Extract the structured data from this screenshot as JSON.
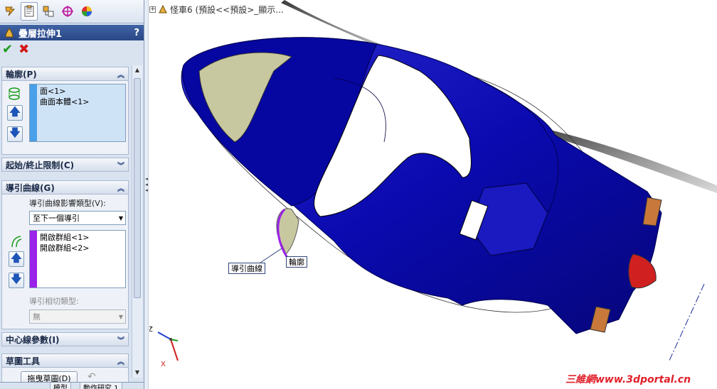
{
  "tabs": [
    {
      "icon": "feature-manager-icon",
      "active": false
    },
    {
      "icon": "property-manager-icon",
      "active": true
    },
    {
      "icon": "configuration-manager-icon",
      "active": false
    },
    {
      "icon": "dimxpert-icon",
      "active": false
    },
    {
      "icon": "display-manager-icon",
      "active": false
    }
  ],
  "property_manager": {
    "title": "疊層拉伸1",
    "help": "?"
  },
  "groups": {
    "profile": {
      "title": "輪廓(P)",
      "items": [
        "面<1>",
        "曲面本體<1>"
      ],
      "list_color": "#4aa0e8"
    },
    "start_end": {
      "title": "起始/終止限制(C)"
    },
    "guides": {
      "title": "導引曲線(G)",
      "influence_label": "導引曲線影響類型(V):",
      "influence_value": "至下一個導引",
      "items": [
        "開啟群組<1>",
        "開啟群組<2>"
      ],
      "list_color": "#9b22e8",
      "tangency_label": "導引相切類型:",
      "tangency_value": "無"
    },
    "centerline": {
      "title": "中心線參數(I)"
    },
    "sketch_tools": {
      "title": "草圖工具",
      "drag_sketch": "拖曳草圖(D)"
    }
  },
  "bottom_tabs": [
    "模型",
    "動作研究 1"
  ],
  "viewport": {
    "tree_label": "怪車6 (預設<<預設>_顯示...",
    "callout_guide": "導引曲線",
    "callout_profile": "輪廓",
    "triad": {
      "z": "Z",
      "x": "X"
    },
    "watermark": "三維網www.3dportal.cn"
  },
  "colors": {
    "body": "#0a0ab0",
    "body_highlight": "#3a3ad8",
    "accent_orange": "#c8783a",
    "accent_red": "#d02020",
    "face_gray": "#c8c8a0"
  }
}
